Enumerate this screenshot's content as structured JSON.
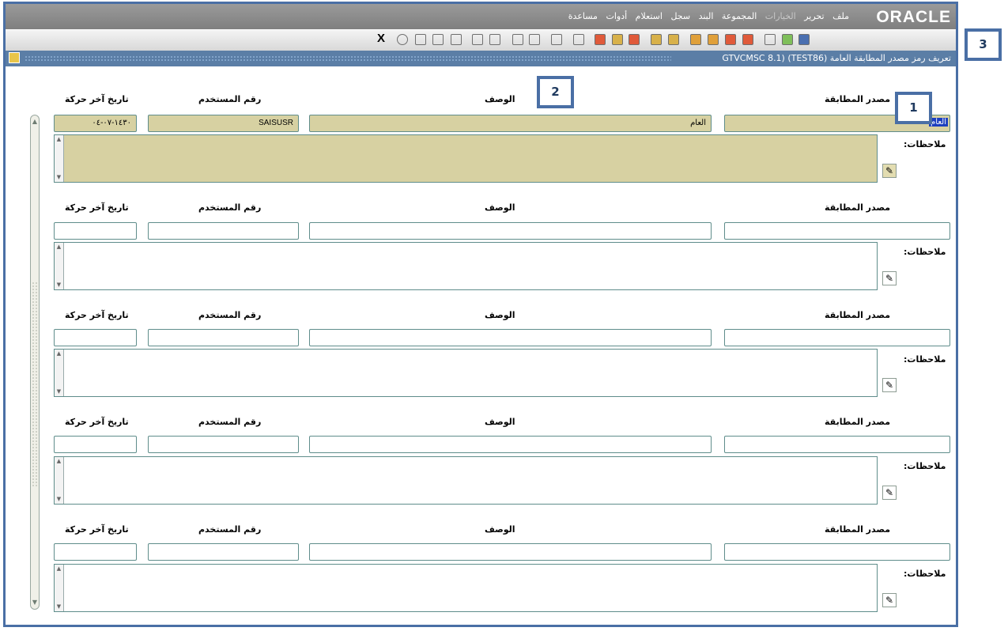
{
  "app": {
    "logo": "ORACLE",
    "menu": [
      "ملف",
      "تحرير",
      "الخيارات",
      "المجموعة",
      "البند",
      "سجل",
      "استعلام",
      "أدوات",
      "مساعدة"
    ],
    "close_label": "X",
    "window_title": "تعريف رمز مصدر المطابقة العامة  GTVCMSC 8.1)  (TEST86)"
  },
  "headers": {
    "source": "مصدر المطابقة",
    "desc": "الوصف",
    "user": "رقم المستخدم",
    "date": "تاريخ آخر حركة",
    "notes": "ملاحظات:"
  },
  "records": [
    {
      "source": "العام",
      "desc": "العام",
      "user": "SAISUSR",
      "date": "١٤٣٠-٠٧-٠٤",
      "notes": ""
    },
    {
      "source": "",
      "desc": "",
      "user": "",
      "date": "",
      "notes": ""
    },
    {
      "source": "",
      "desc": "",
      "user": "",
      "date": "",
      "notes": ""
    },
    {
      "source": "",
      "desc": "",
      "user": "",
      "date": "",
      "notes": ""
    },
    {
      "source": "",
      "desc": "",
      "user": "",
      "date": "",
      "notes": ""
    }
  ],
  "callouts": [
    "1",
    "2",
    "3"
  ],
  "colors": {
    "active_field": "#d7d1a2",
    "frame": "#4a6fa5",
    "title_bar": "#5b7ea6"
  }
}
